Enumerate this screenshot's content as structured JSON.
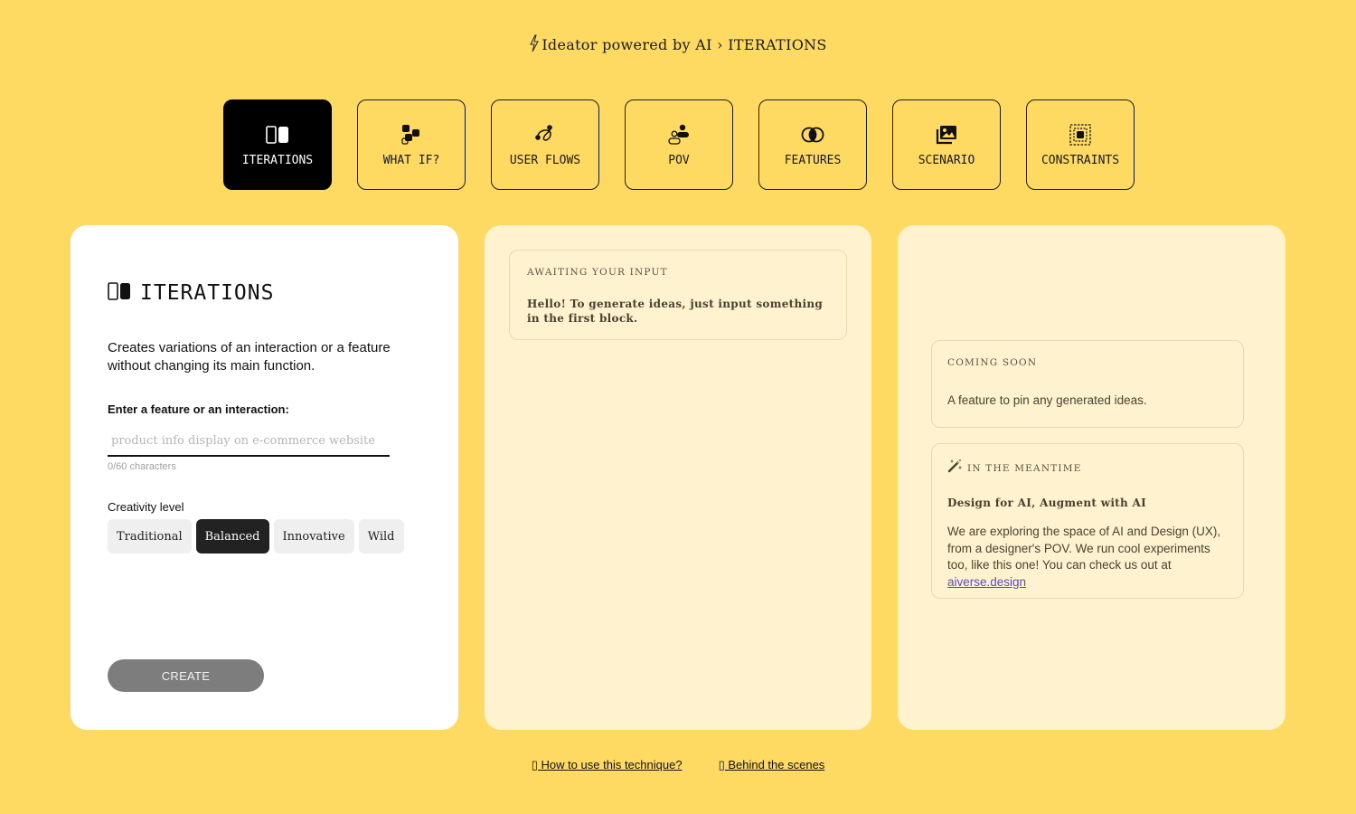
{
  "header": {
    "app_name": "Ideator powered by AI",
    "separator": "›",
    "current_section": "ITERATIONS",
    "icon": "lightning-bolt-icon"
  },
  "tabs": [
    {
      "label": "ITERATIONS",
      "icon": "split-columns-icon",
      "active": true
    },
    {
      "label": "WHAT IF?",
      "icon": "shapes-cluster-icon",
      "active": false
    },
    {
      "label": "USER FLOWS",
      "icon": "flow-path-icon",
      "active": false
    },
    {
      "label": "POV",
      "icon": "users-icon",
      "active": false
    },
    {
      "label": "FEATURES",
      "icon": "overlapping-circles-icon",
      "active": false
    },
    {
      "label": "SCENARIO",
      "icon": "images-icon",
      "active": false
    },
    {
      "label": "CONSTRAINTS",
      "icon": "dashed-frame-icon",
      "active": false
    }
  ],
  "left_panel": {
    "title": "ITERATIONS",
    "description": "Creates variations of an interaction or a feature without changing its main function.",
    "field_label": "Enter a feature or an interaction:",
    "input_value": "",
    "input_placeholder": "product info display on e-commerce website",
    "char_counter": "0/60 characters",
    "creativity_label": "Creativity level",
    "creativity_levels": [
      "Traditional",
      "Balanced",
      "Innovative",
      "Wild"
    ],
    "creativity_selected": "Balanced",
    "create_label": "CREATE"
  },
  "middle_panel": {
    "eyebrow": "AWAITING YOUR INPUT",
    "message": "Hello! To generate ideas, just input something in the first block."
  },
  "right_panel": {
    "coming_soon": {
      "eyebrow": "COMING SOON",
      "body": "A feature to pin any generated ideas."
    },
    "meantime": {
      "eyebrow": "IN THE MEANTIME",
      "icon": "magic-wand-icon",
      "title": "Design for AI, Augment with AI",
      "body": "We are exploring the space of AI and Design (UX), from a designer's POV. We run cool experiments too, like this one! You can check us out at ",
      "link_text": "aiverse.design"
    }
  },
  "footer": {
    "links": [
      {
        "label": "▯ How to use this technique?"
      },
      {
        "label": "▯ Behind the scenes"
      }
    ]
  },
  "colors": {
    "background": "#FFDA63",
    "panel_cream": "#FFF3CF",
    "active_tab": "#000000",
    "selected_level": "#222222",
    "create_button": "#7D7D7D",
    "link": "#5B4CC4"
  }
}
